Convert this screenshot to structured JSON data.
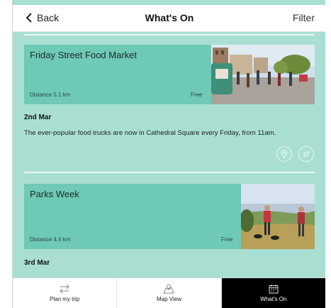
{
  "header": {
    "back_label": "Back",
    "title": "What's On",
    "filter_label": "Filter"
  },
  "events": [
    {
      "title": "Friday Street Food Market",
      "distance": "Distance 5.1 km",
      "price": "Free",
      "date": "2nd Mar",
      "description": "The ever-popular food trucks are now in Cathedral Square every Friday, from 11am."
    },
    {
      "title": "Parks Week",
      "distance": "Distance 4.4 km",
      "price": "Free",
      "date": "3rd Mar",
      "description": ""
    }
  ],
  "tabs": [
    {
      "label": "Plan my trip",
      "icon": "swap-arrows-icon"
    },
    {
      "label": "Map View",
      "icon": "map-icon"
    },
    {
      "label": "What's On",
      "icon": "calendar-icon",
      "active": true
    }
  ],
  "colors": {
    "background": "#a9dfd3",
    "card": "#6ec9b6",
    "active_tab": "#000000"
  }
}
